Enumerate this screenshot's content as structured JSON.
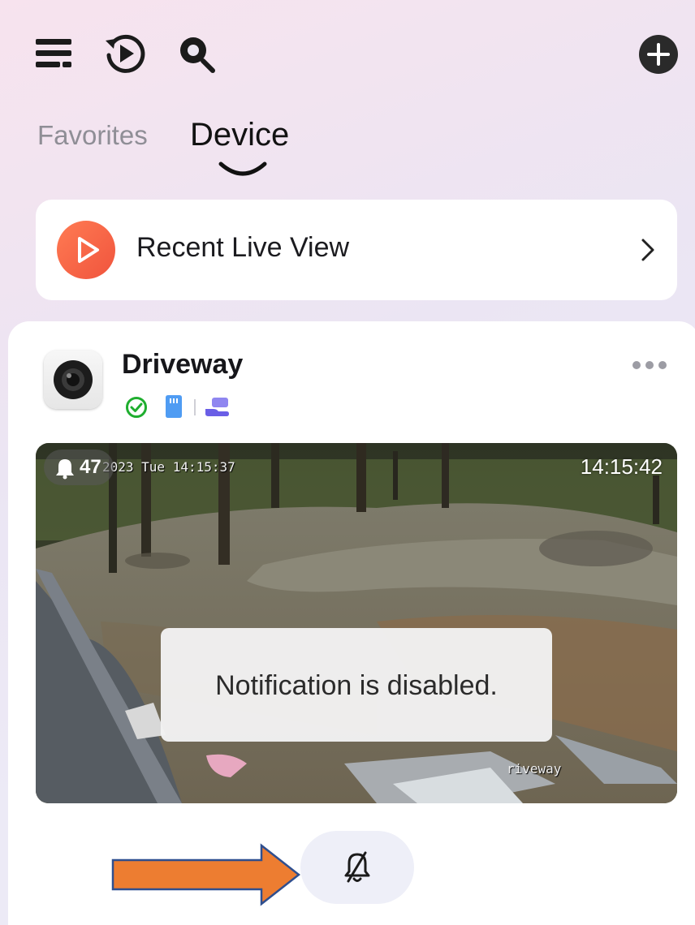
{
  "toolbar": {
    "icons": [
      "menu-icon",
      "playback-icon",
      "search-icon",
      "add-icon"
    ]
  },
  "tabs": {
    "favorites": "Favorites",
    "device": "Device",
    "active": "Device"
  },
  "recent": {
    "label": "Recent Live View"
  },
  "device": {
    "name": "Driveway",
    "status_icons": [
      "online-check-icon",
      "sd-card-icon",
      "share-icon"
    ],
    "feed": {
      "osd_datetime": "2023 Tue 14:15:37",
      "alert_count": "47",
      "live_time": "14:15:42",
      "osd_name": "riveway"
    },
    "toast": "Notification is disabled."
  },
  "colors": {
    "accent_orange": "#f0543d",
    "online_green": "#1fae2f",
    "sd_blue": "#4f9cf3",
    "share_purple": "#6a5ee6",
    "annotation_arrow": "#ed7d31"
  }
}
